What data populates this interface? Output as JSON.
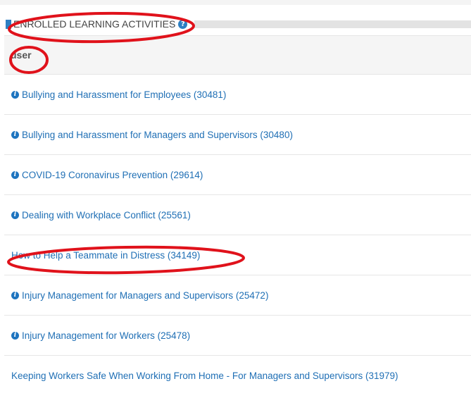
{
  "section": {
    "title": "ENROLLED LEARNING ACTIVITIES",
    "help_icon": "question-circle-icon",
    "accent_color": "#2c7fc3"
  },
  "table": {
    "column_header": "user",
    "rows": [
      {
        "label": "Bullying and Harassment for Employees (30481)",
        "has_info_icon": true
      },
      {
        "label": "Bullying and Harassment for Managers and Supervisors (30480)",
        "has_info_icon": true
      },
      {
        "label": "COVID-19 Coronavirus Prevention (29614)",
        "has_info_icon": true
      },
      {
        "label": "Dealing with Workplace Conflict (25561)",
        "has_info_icon": true
      },
      {
        "label": "How to Help a Teammate in Distress (34149)",
        "has_info_icon": false
      },
      {
        "label": "Injury Management for Managers and Supervisors (25472)",
        "has_info_icon": true
      },
      {
        "label": "Injury Management for Workers (25478)",
        "has_info_icon": true
      },
      {
        "label": "Keeping Workers Safe When Working From Home - For Managers and Supervisors (31979)",
        "has_info_icon": false
      }
    ],
    "link_color": "#1f6fb5",
    "info_icon": "info-circle-icon"
  },
  "annotation": {
    "color": "#e0121b"
  }
}
